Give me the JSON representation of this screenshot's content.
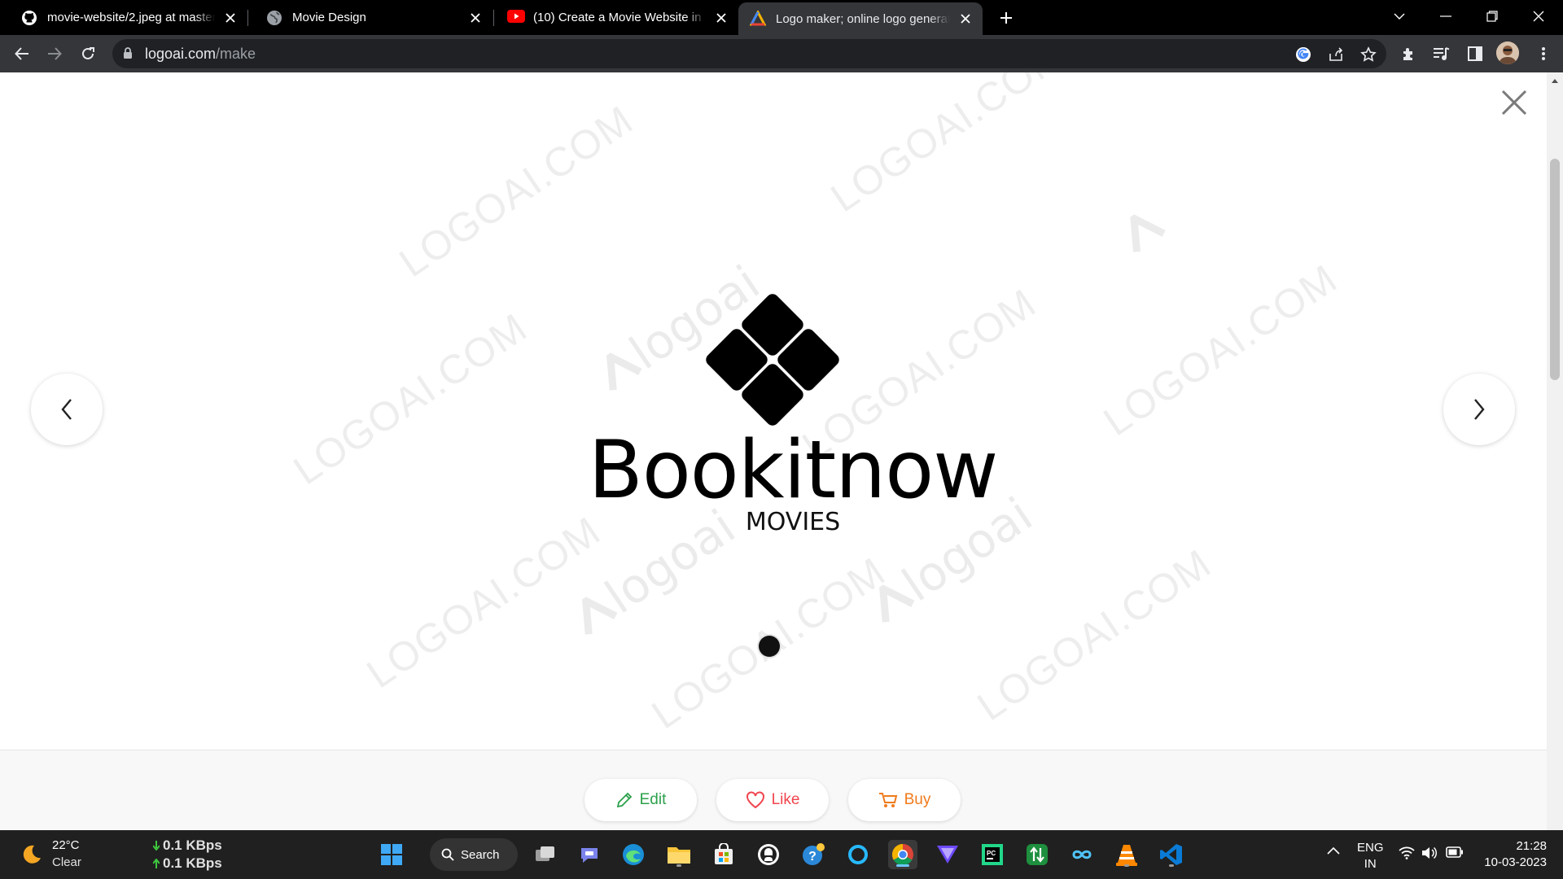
{
  "browser": {
    "tabs": [
      {
        "title": "movie-website/2.jpeg at master · ",
        "favicon": "github-icon"
      },
      {
        "title": "Movie Design",
        "favicon": "globe-icon"
      },
      {
        "title": "(10) Create a Movie Website in 9",
        "favicon": "youtube-icon"
      },
      {
        "title": "Logo maker; online logo generato",
        "favicon": "logoai-icon",
        "active": true
      }
    ],
    "url_host": "logoai.com",
    "url_path": "/make"
  },
  "page": {
    "brand_name": "Bookitnow",
    "brand_subtitle": "MOVIES",
    "watermark_texts": [
      "LOGOAI.COM",
      "logoai"
    ],
    "actions": {
      "edit": "Edit",
      "like": "Like",
      "buy": "Buy"
    },
    "colors": {
      "edit": "#2ca04b",
      "like": "#f0454f",
      "buy": "#f07b1c"
    }
  },
  "taskbar": {
    "weather_temp": "22°C",
    "weather_condition": "Clear",
    "net_down": "0.1 KBps",
    "net_up": "0.1 KBps",
    "search_label": "Search",
    "language": "ENG",
    "region": "IN",
    "time": "21:28",
    "date": "10-03-2023"
  }
}
